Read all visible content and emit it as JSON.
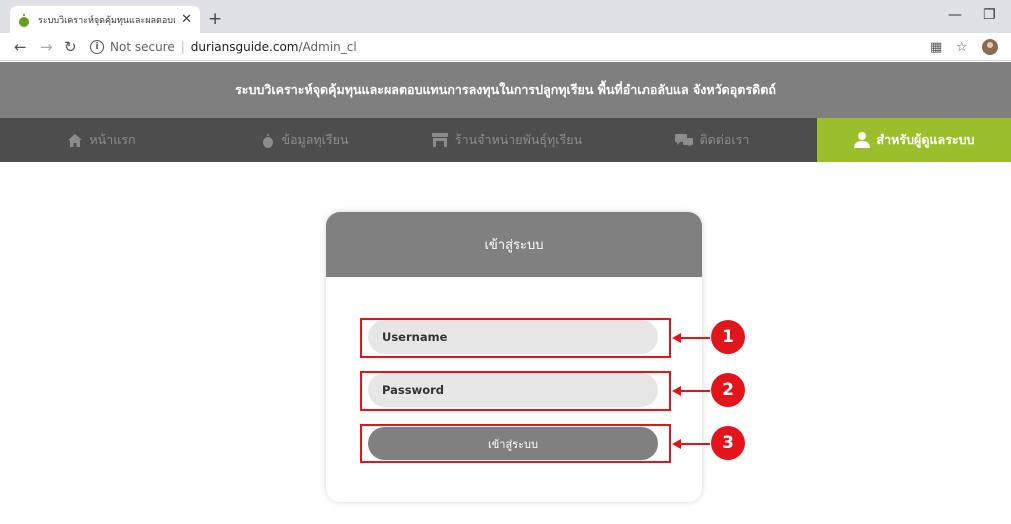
{
  "browser": {
    "tab_title": "ระบบวิเคราะห์จุดคุ้มทุนและผลตอบแทนก",
    "new_tab": "+",
    "close": "✕",
    "not_secure": "Not secure",
    "url_host": "duriansguide.com",
    "url_path": "/Admin_cl"
  },
  "site": {
    "banner_title": "ระบบวิเคราะห์จุดคุ้มทุนและผลตอบแทนการลงทุนในการปลูกทุเรียน พื้นที่อำเภอลับแล จังหวัดอุตรดิตถ์",
    "nav": [
      {
        "label": "หน้าแรก",
        "icon": "home-icon"
      },
      {
        "label": "ข้อมูลทุเรียน",
        "icon": "durian-icon"
      },
      {
        "label": "ร้านจำหน่ายพันธุ์ทุเรียน",
        "icon": "shop-icon"
      },
      {
        "label": "ติดต่อเรา",
        "icon": "chat-icon"
      },
      {
        "label": "สำหรับผู้ดูแลระบบ",
        "icon": "admin-user-icon"
      }
    ]
  },
  "login": {
    "title": "เข้าสู่ระบบ",
    "username_placeholder": "Username",
    "password_placeholder": "Password",
    "submit_label": "เข้าสู่ระบบ"
  },
  "annotations": [
    "1",
    "2",
    "3"
  ],
  "colors": {
    "accent_green": "#9bbf2b",
    "annotation_red": "#e2141c",
    "banner_gray": "#7f7f7f",
    "nav_dark": "#4d4d4d"
  }
}
